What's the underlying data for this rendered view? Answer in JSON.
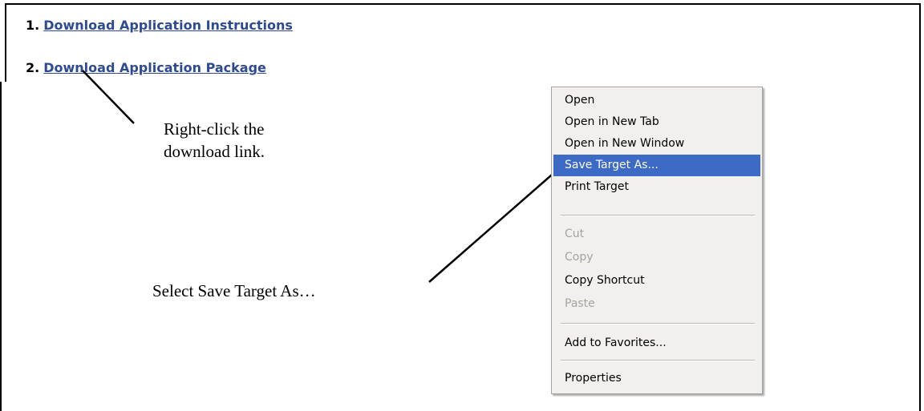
{
  "links": [
    {
      "number": "1.",
      "label": "Download Application Instructions"
    },
    {
      "number": "2.",
      "label": "Download Application Package"
    }
  ],
  "annotations": {
    "right_click": "Right-click the download link.",
    "select_save": "Select Save Target As…"
  },
  "context_menu": {
    "items": [
      {
        "label": "Open",
        "state": "enabled"
      },
      {
        "label": "Open in New Tab",
        "state": "enabled"
      },
      {
        "label": "Open in New Window",
        "state": "enabled"
      },
      {
        "label": "Save Target As...",
        "state": "highlighted"
      },
      {
        "label": "Print Target",
        "state": "enabled"
      },
      {
        "label": "Cut",
        "state": "disabled"
      },
      {
        "label": "Copy",
        "state": "disabled"
      },
      {
        "label": "Copy Shortcut",
        "state": "enabled"
      },
      {
        "label": "Paste",
        "state": "disabled"
      },
      {
        "label": "Add to Favorites...",
        "state": "enabled"
      },
      {
        "label": "Properties",
        "state": "enabled"
      }
    ]
  },
  "colors": {
    "link": "#2e4a93",
    "menu_background": "#f1f0ee",
    "menu_highlight": "#3d6ac5",
    "menu_disabled_text": "#a5a49c"
  }
}
